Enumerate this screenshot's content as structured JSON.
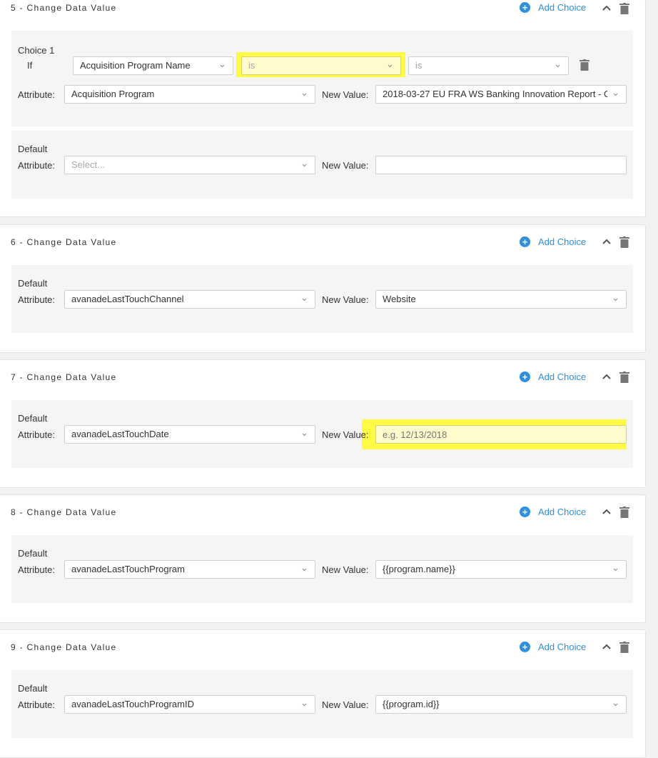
{
  "add_choice_label": "Add Choice",
  "cards": [
    {
      "title": "5 - Change Data Value",
      "choice": {
        "label": "Choice 1",
        "if_label": "If",
        "condition_field": "Acquisition Program Name",
        "operator": "is",
        "operand_placeholder": "is",
        "attribute_label": "Attribute:",
        "attribute": "Acquisition Program",
        "new_value_label": "New Value:",
        "new_value": "2018-03-27 EU FRA WS Banking Innovation Report - C"
      },
      "default": {
        "label": "Default",
        "attribute_label": "Attribute:",
        "attribute_placeholder": "Select...",
        "new_value_label": "New Value:",
        "new_value": ""
      }
    },
    {
      "title": "6 - Change Data Value",
      "default": {
        "label": "Default",
        "attribute_label": "Attribute:",
        "attribute": "avanadeLastTouchChannel",
        "new_value_label": "New Value:",
        "new_value": "Website"
      }
    },
    {
      "title": "7 - Change Data Value",
      "default": {
        "label": "Default",
        "attribute_label": "Attribute:",
        "attribute": "avanadeLastTouchDate",
        "new_value_label": "New Value:",
        "new_value_placeholder": "e.g. 12/13/2018"
      }
    },
    {
      "title": "8 - Change Data Value",
      "default": {
        "label": "Default",
        "attribute_label": "Attribute:",
        "attribute": "avanadeLastTouchProgram",
        "new_value_label": "New Value:",
        "new_value": "{{program.name}}"
      }
    },
    {
      "title": "9 - Change Data Value",
      "default": {
        "label": "Default",
        "attribute_label": "Attribute:",
        "attribute": "avanadeLastTouchProgramID",
        "new_value_label": "New Value:",
        "new_value": "{{program.id}}"
      }
    }
  ],
  "colors": {
    "accent": "#2f8fdc",
    "highlight": "#fffb44",
    "panel": "#f5f5f5"
  },
  "icons": [
    "plus-circle-icon",
    "chevron-up-icon",
    "trash-icon",
    "chevron-down-icon"
  ]
}
